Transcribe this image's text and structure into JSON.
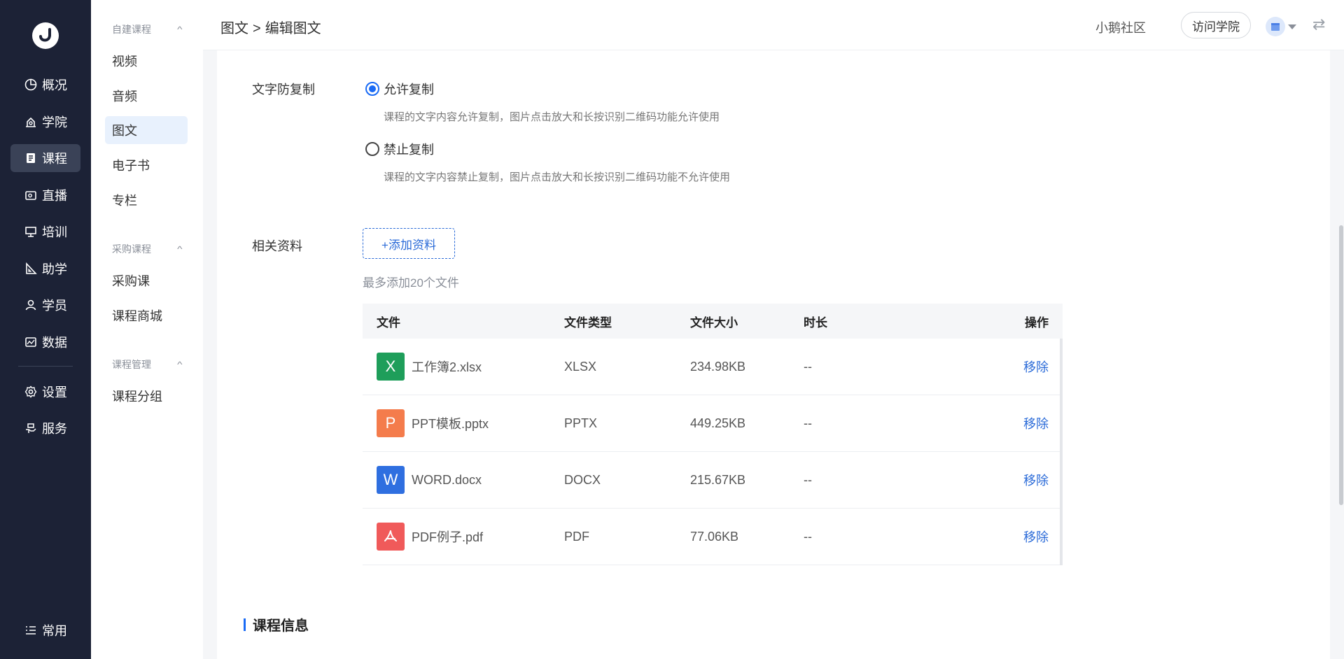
{
  "nav": {
    "items": [
      {
        "label": "概况",
        "icon": "pie-chart-icon"
      },
      {
        "label": "学院",
        "icon": "academy-icon"
      },
      {
        "label": "课程",
        "icon": "course-book-icon"
      },
      {
        "label": "直播",
        "icon": "live-camera-icon"
      },
      {
        "label": "培训",
        "icon": "training-board-icon"
      },
      {
        "label": "助学",
        "icon": "ruler-triangle-icon"
      },
      {
        "label": "学员",
        "icon": "user-icon"
      },
      {
        "label": "数据",
        "icon": "data-image-icon"
      },
      {
        "label": "设置",
        "icon": "gear-icon"
      },
      {
        "label": "服务",
        "icon": "service-hand-icon"
      }
    ],
    "active": "课程",
    "bottom_label": "常用"
  },
  "submenu": {
    "group1": "自建课程",
    "group1_items": [
      "视频",
      "音频",
      "图文",
      "电子书",
      "专栏"
    ],
    "active": "图文",
    "group2": "采购课程",
    "group2_items": [
      "采购课",
      "课程商城"
    ],
    "group3": "课程管理",
    "group3_items": [
      "课程分组"
    ]
  },
  "header": {
    "breadcrumb_parent": "图文",
    "breadcrumb_sep": ">",
    "breadcrumb_current": "编辑图文",
    "community_link": "小鹅社区",
    "visit_button": "访问学院"
  },
  "copy_protect": {
    "label": "文字防复制",
    "option_allow": "允许复制",
    "option_allow_hint": "课程的文字内容允许复制，图片点击放大和长按识别二维码功能允许使用",
    "option_deny": "禁止复制",
    "option_deny_hint": "课程的文字内容禁止复制，图片点击放大和长按识别二维码功能不允许使用",
    "selected": "允许复制"
  },
  "materials": {
    "label": "相关资料",
    "add_button": "+添加资料",
    "note": "最多添加20个文件",
    "columns": [
      "文件",
      "文件类型",
      "文件大小",
      "时长",
      "操作"
    ],
    "rows": [
      {
        "name": "工作簿2.xlsx",
        "type": "XLSX",
        "size": "234.98KB",
        "duration": "--",
        "action": "移除",
        "icon_letter": "X",
        "icon_color": "#1e9e5a"
      },
      {
        "name": "PPT模板.pptx",
        "type": "PPTX",
        "size": "449.25KB",
        "duration": "--",
        "action": "移除",
        "icon_letter": "P",
        "icon_color": "#f47c4c"
      },
      {
        "name": "WORD.docx",
        "type": "DOCX",
        "size": "215.67KB",
        "duration": "--",
        "action": "移除",
        "icon_letter": "W",
        "icon_color": "#2f6fe0"
      },
      {
        "name": "PDF例子.pdf",
        "type": "PDF",
        "size": "77.06KB",
        "duration": "--",
        "action": "移除",
        "icon_letter": "",
        "icon_color": "#f05a5a"
      }
    ]
  },
  "section": {
    "course_info_title": "课程信息"
  },
  "colors": {
    "nav_bg": "#1c2236",
    "accent": "#1a6bf5",
    "link": "#2b6bd8"
  }
}
